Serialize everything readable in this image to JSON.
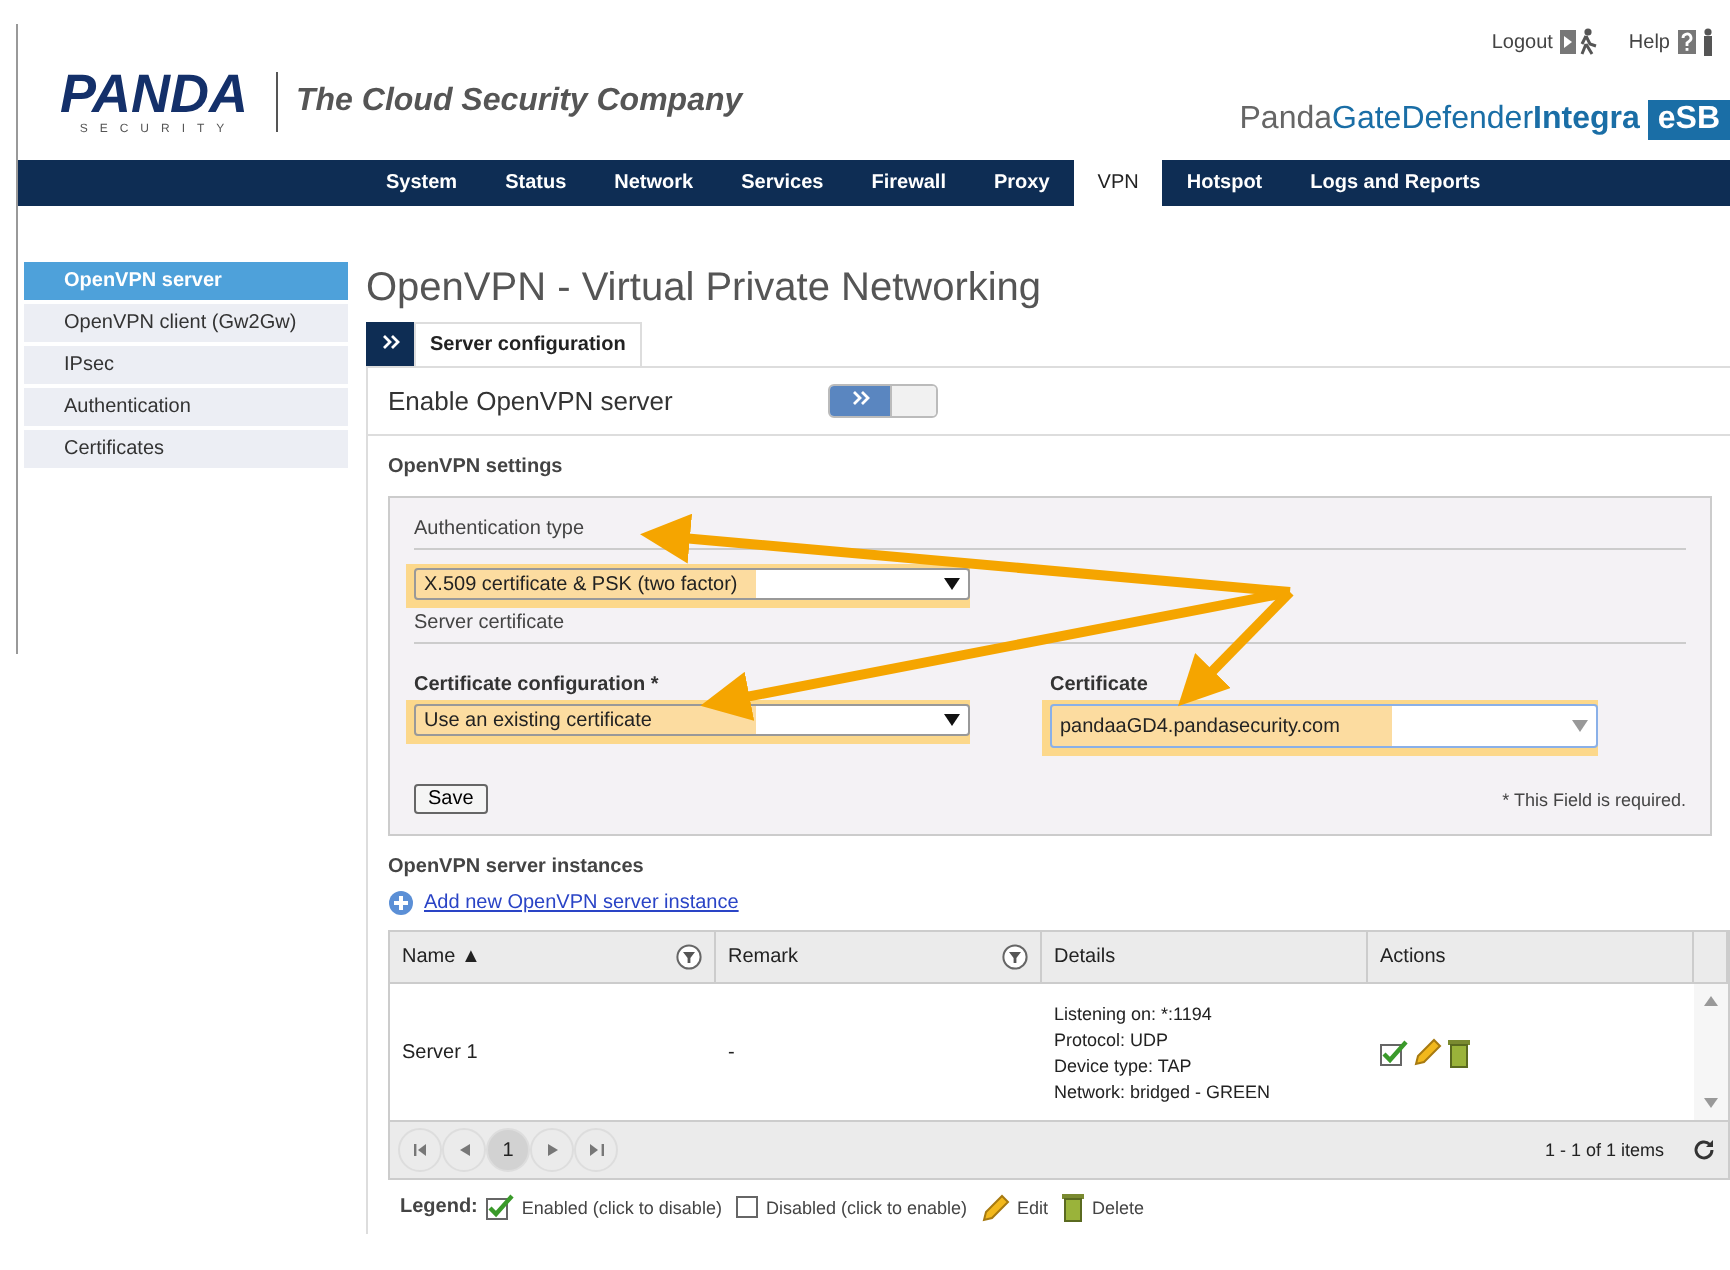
{
  "header": {
    "logo": "PANDA",
    "logo_sub": "SECURITY",
    "tagline": "The Cloud Security Company",
    "top_links": [
      {
        "label": "Logout",
        "kind": "logout"
      },
      {
        "label": "Help",
        "kind": "help"
      }
    ],
    "product": {
      "prefix": "Panda",
      "name": "GateDefender",
      "name_bold": "Integra",
      "badge": "eSB"
    }
  },
  "nav": [
    {
      "label": "System",
      "selected": false
    },
    {
      "label": "Status",
      "selected": false
    },
    {
      "label": "Network",
      "selected": false
    },
    {
      "label": "Services",
      "selected": false
    },
    {
      "label": "Firewall",
      "selected": false
    },
    {
      "label": "Proxy",
      "selected": false
    },
    {
      "label": "VPN",
      "selected": true
    },
    {
      "label": "Hotspot",
      "selected": false
    },
    {
      "label": "Logs and Reports",
      "selected": false
    }
  ],
  "sidebar": [
    {
      "label": "OpenVPN server",
      "selected": true
    },
    {
      "label": "OpenVPN client (Gw2Gw)",
      "selected": false
    },
    {
      "label": "IPsec",
      "selected": false
    },
    {
      "label": "Authentication",
      "selected": false
    },
    {
      "label": "Certificates",
      "selected": false
    }
  ],
  "page_title": "OpenVPN - Virtual Private Networking",
  "tabs": [
    {
      "label": "Server configuration",
      "selected": true
    }
  ],
  "enable": {
    "label": "Enable OpenVPN server",
    "on": true
  },
  "settings": {
    "title": "OpenVPN settings",
    "auth_label": "Authentication type",
    "auth_value": "X.509 certificate & PSK (two factor)",
    "auth_highlighted": true,
    "server_cert_label": "Server certificate",
    "cert_config": {
      "label": "Certificate configuration *",
      "value": "Use an existing certificate",
      "highlighted": true
    },
    "certificate": {
      "label": "Certificate",
      "value": "pandaaGD4.pandasecurity.com",
      "highlighted": true
    },
    "save": "Save",
    "required_note": "* This Field is required."
  },
  "instances": {
    "title": "OpenVPN server instances",
    "add_link": "Add new OpenVPN server instance",
    "columns": [
      {
        "label": "Name ▲",
        "filter": true
      },
      {
        "label": "Remark",
        "filter": true
      },
      {
        "label": "Details",
        "filter": false
      },
      {
        "label": "Actions",
        "filter": false
      }
    ],
    "rows": [
      {
        "name": "Server 1",
        "remark": "-",
        "details": [
          "Listening on: *:1194",
          "Protocol: UDP",
          "Device type: TAP",
          "Network: bridged - GREEN"
        ],
        "enabled": true
      }
    ],
    "pages": [
      {
        "label": "1",
        "selected": true
      }
    ],
    "summary": "1 - 1 of 1 items"
  },
  "legend": {
    "title": "Legend:",
    "items": [
      {
        "kind": "enabled",
        "label": "Enabled (click to disable)"
      },
      {
        "kind": "disabled",
        "label": "Disabled (click to enable)"
      },
      {
        "kind": "edit",
        "label": "Edit"
      },
      {
        "kind": "delete",
        "label": "Delete"
      }
    ]
  }
}
